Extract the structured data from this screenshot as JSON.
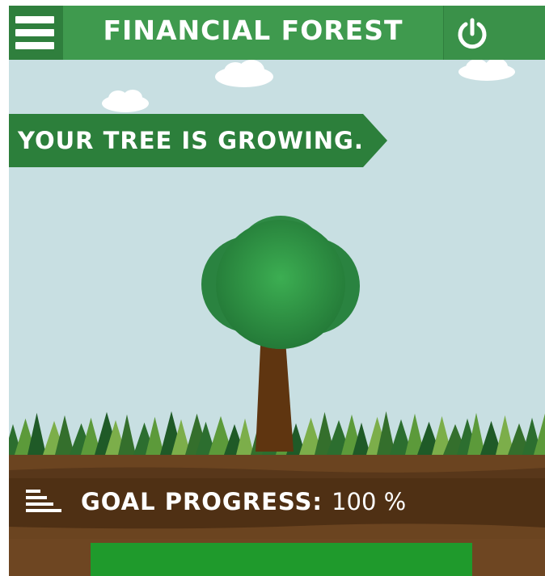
{
  "header": {
    "title": "FINANCIAL FOREST",
    "menu_icon": "hamburger-menu-icon",
    "power_icon": "power-icon"
  },
  "banner": {
    "text": "YOUR TREE IS GROWING."
  },
  "goal": {
    "label": "GOAL PROGRESS:",
    "value_text": "100 %",
    "progress_fraction": 1.0,
    "icon": "progress-lines-icon"
  },
  "colors": {
    "header_green": "#3f9a4e",
    "header_dark_green": "#2f7f3d",
    "sky": "#c8dfe2",
    "banner_green": "#2c7f3b",
    "tree_canopy": "#2f8a45",
    "tree_trunk": "#5f3510",
    "soil": "#6b4420",
    "soil_dark": "#4f3014",
    "progress_fill": "#1f9a2c"
  }
}
